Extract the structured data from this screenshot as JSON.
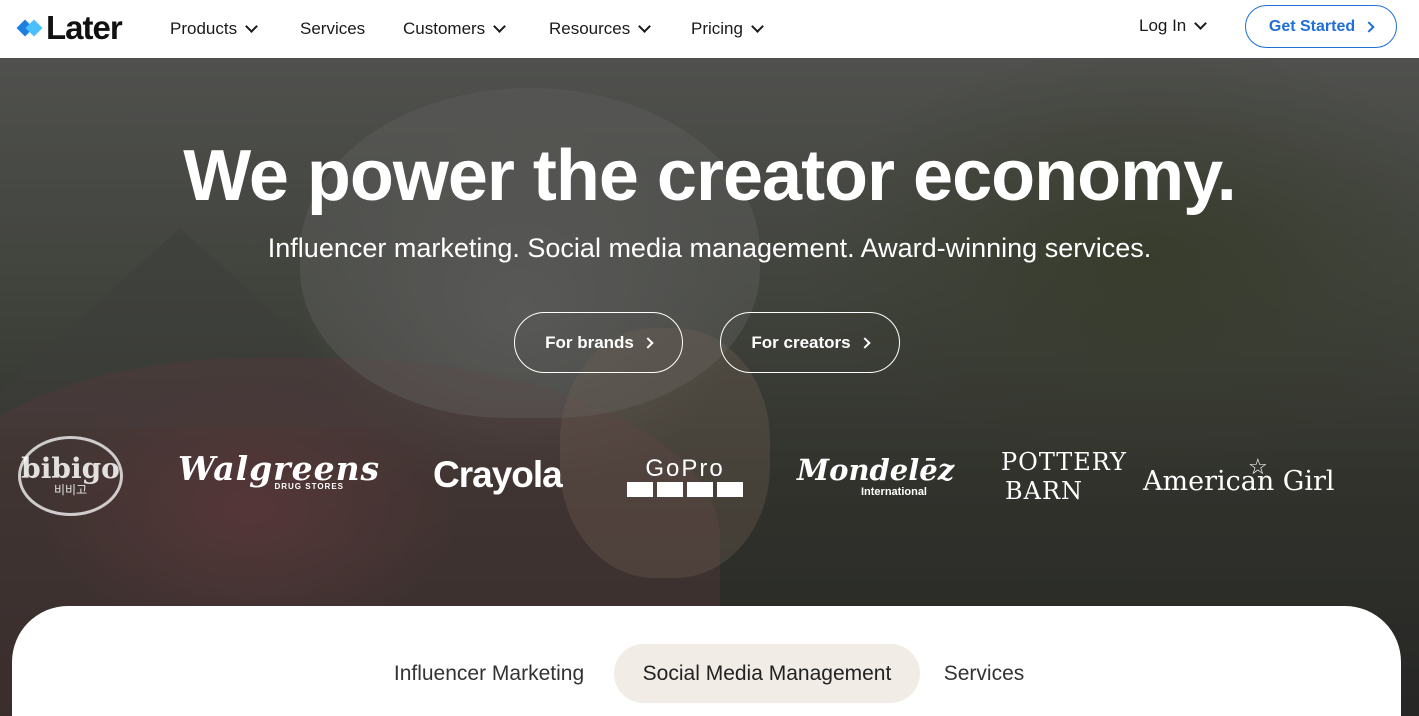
{
  "nav": {
    "logo": "Later",
    "menu": [
      "Products",
      "Services",
      "Customers",
      "Resources",
      "Pricing"
    ],
    "login": "Log In",
    "cta": "Get Started"
  },
  "hero": {
    "title": "We power the creator economy.",
    "subtitle": "Influencer marketing. Social media management. Award-winning services.",
    "buttons": [
      "For brands",
      "For creators"
    ]
  },
  "brands": {
    "bibigo": {
      "name": "bibigo",
      "sub": "비비고"
    },
    "walgreens": {
      "name": "Walgreens",
      "sub": "DRUG STORES"
    },
    "crayola": {
      "name": "Crayola"
    },
    "gopro": {
      "name": "GoPro"
    },
    "mondelez": {
      "name": "Mondelēz",
      "sub": "International"
    },
    "pottery": {
      "line1": "POTTERY",
      "line2": "BARN"
    },
    "american": {
      "name": "American Girl"
    }
  },
  "tabs": [
    "Influencer Marketing",
    "Social Media Management",
    "Services"
  ],
  "active_tab": "Social Media Management",
  "colors": {
    "accent": "#1f6fd8",
    "active_tab_bg": "#f1ece6"
  },
  "icons": [
    "later-logo-icon",
    "chevron-down-icon",
    "chevron-right-icon"
  ]
}
